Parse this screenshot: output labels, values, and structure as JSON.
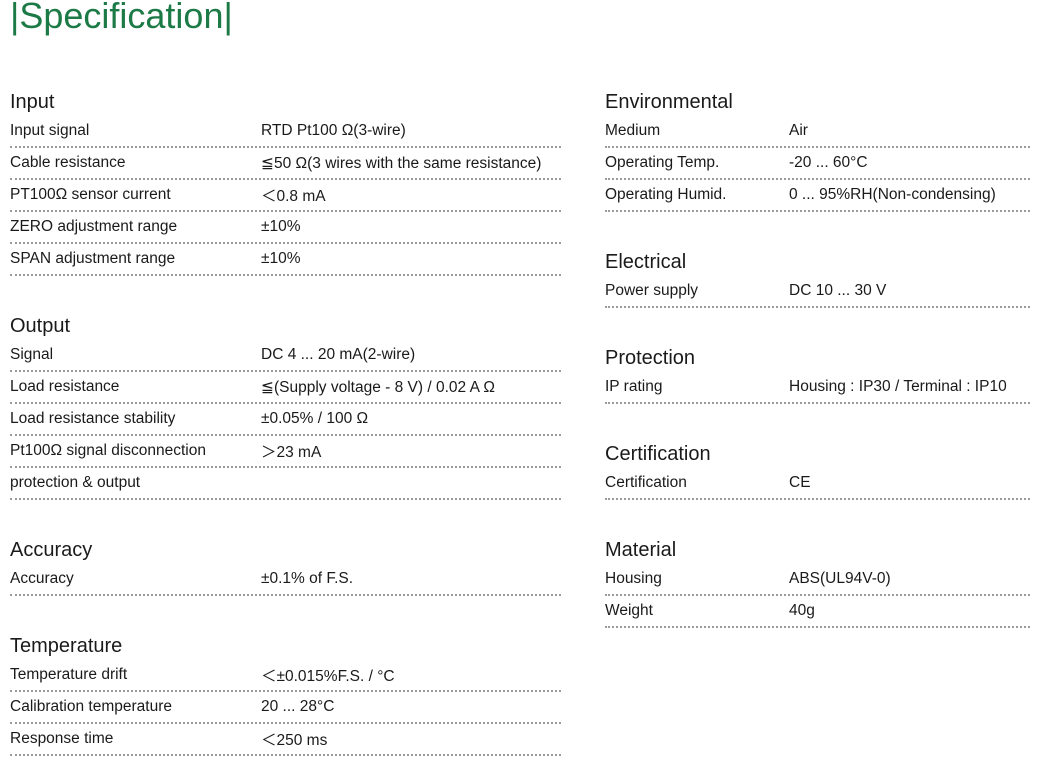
{
  "title": "Specification",
  "left": [
    {
      "heading": "Input",
      "rows": [
        {
          "label": "Input signal",
          "value": "RTD Pt100 Ω(3-wire)"
        },
        {
          "label": "Cable resistance",
          "value": "≦50 Ω(3 wires with the same resistance)"
        },
        {
          "label": "PT100Ω sensor current",
          "value": "＜0.8 mA"
        },
        {
          "label": "ZERO adjustment range",
          "value": "±10%"
        },
        {
          "label": "SPAN adjustment range",
          "value": "±10%"
        }
      ]
    },
    {
      "heading": "Output",
      "rows": [
        {
          "label": "Signal",
          "value": "DC 4 ... 20 mA(2-wire)"
        },
        {
          "label": "Load resistance",
          "value": "≦(Supply voltage - 8 V) / 0.02 A Ω"
        },
        {
          "label": "Load resistance stability",
          "value": "±0.05% / 100 Ω"
        },
        {
          "label": "Pt100Ω signal disconnection",
          "value": "＞23 mA"
        },
        {
          "label": "protection & output",
          "value": ""
        }
      ]
    },
    {
      "heading": "Accuracy",
      "rows": [
        {
          "label": "Accuracy",
          "value": "±0.1% of F.S."
        }
      ]
    },
    {
      "heading": "Temperature",
      "rows": [
        {
          "label": "Temperature drift",
          "value": "＜±0.015%F.S. / °C"
        },
        {
          "label": "Calibration temperature",
          "value": "20 ... 28°C"
        },
        {
          "label": "Response time",
          "value": "＜250 ms"
        }
      ]
    }
  ],
  "right": [
    {
      "heading": "Environmental",
      "rows": [
        {
          "label": "Medium",
          "value": "Air"
        },
        {
          "label": "Operating Temp.",
          "value": "-20 ... 60°C"
        },
        {
          "label": "Operating Humid.",
          "value": "0 ... 95%RH(Non-condensing)"
        }
      ]
    },
    {
      "heading": "Electrical",
      "rows": [
        {
          "label": "Power supply",
          "value": "DC 10 ... 30 V"
        }
      ]
    },
    {
      "heading": "Protection",
      "rows": [
        {
          "label": "IP rating",
          "value": "Housing : IP30 / Terminal : IP10"
        }
      ]
    },
    {
      "heading": "Certification",
      "rows": [
        {
          "label": "Certification",
          "value": "CE"
        }
      ]
    },
    {
      "heading": "Material",
      "rows": [
        {
          "label": "Housing",
          "value": "ABS(UL94V-0)"
        },
        {
          "label": "Weight",
          "value": "40g"
        }
      ]
    }
  ]
}
